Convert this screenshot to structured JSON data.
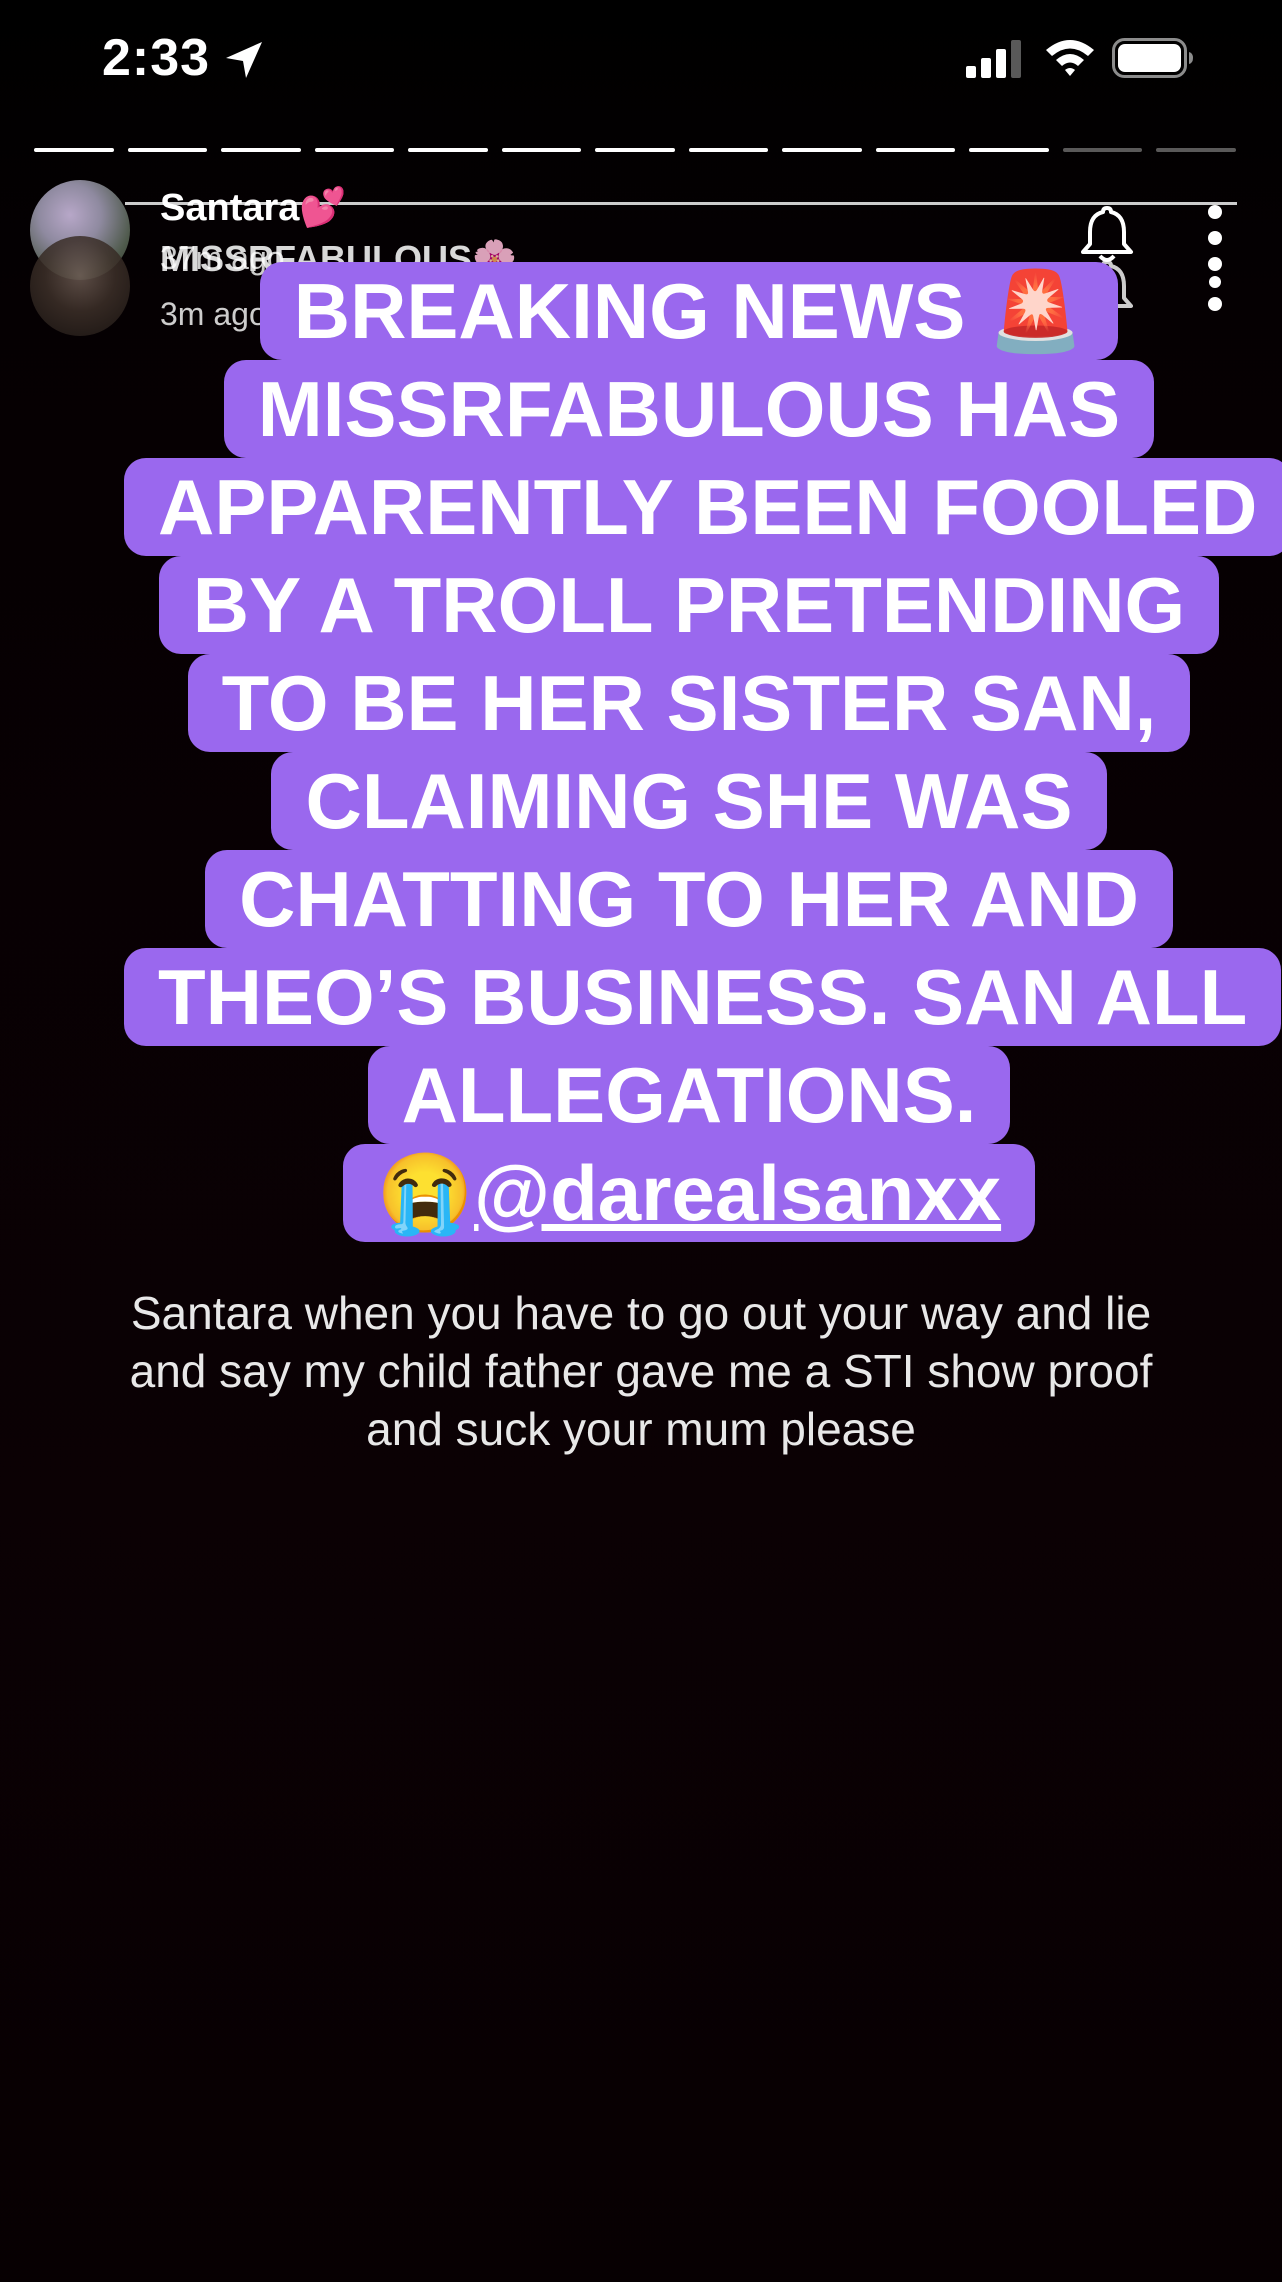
{
  "status_bar": {
    "time": "2:33",
    "icons": [
      "location-arrow-icon",
      "cellular-signal-icon",
      "wifi-icon",
      "battery-icon"
    ]
  },
  "story_progress": {
    "segments_total": 13,
    "segments_viewed": 11
  },
  "header": {
    "stories": [
      {
        "username": "Santara💕",
        "time_ago": "37m ago"
      },
      {
        "username": "MISSRFABULOUS🌸",
        "time_ago": "3m ago"
      }
    ],
    "icons": [
      "notification-bell-icon",
      "more-options-icon"
    ]
  },
  "headline": {
    "lines": [
      "BREAKING NEWS 🚨",
      "MISSRFABULOUS HAS",
      "APPARENTLY BEEN FOOLED",
      "BY A TROLL PRETENDING",
      "TO BE HER SISTER SAN,",
      "CLAIMING SHE WAS",
      "CHATTING TO HER AND",
      "THEO’S BUSINESS. SAN ALL",
      "ALLEGATIONS."
    ],
    "emoji": "😭",
    "handle": "@darealsanxx",
    "background_color": "#9a68ee"
  },
  "caption": {
    "lines": [
      "Santara when you have to go out your way and lie",
      "and say my child father gave me a STI show proof",
      "and suck your mum please"
    ]
  }
}
